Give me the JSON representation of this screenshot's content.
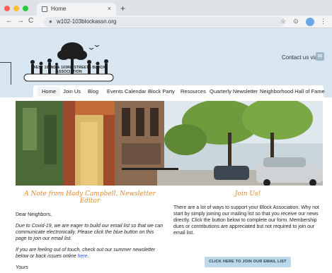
{
  "browser": {
    "tab_title": "Home",
    "tab_close": "×",
    "new_tab": "+",
    "url": "w102-103blockassn.org",
    "back": "←",
    "forward": "→",
    "reload": "C",
    "star": "☆",
    "ext": "⊙",
    "menu": "⋮",
    "dot_colors": [
      "#ff5f57",
      "#febc2e",
      "#28c840"
    ]
  },
  "header": {
    "logo_text": "WEST 102ND & 103RD STREETS BLOCK ASSOCIATION",
    "contact": "Contact us via"
  },
  "nav": {
    "items": [
      "Home",
      "Join Us",
      "Blog",
      "Events Calendar",
      "Block Party",
      "Resources",
      "Quarterly Newsletter",
      "Neighborhood Hall of Fame"
    ]
  },
  "left": {
    "title": "A Note from Hady Campbell, Newsletter Editor",
    "greeting": "Dear Neighbors,",
    "p1": "Due to Covid-19, we are eager to build our email list so that we can communicate electronically. Please click the blue button on this page to join our email list.",
    "p2_a": "If you are feeling out of touch, check out our summer newsletter below or back issues online ",
    "p2_link": "here",
    "p2_b": ".",
    "closing": "Yours"
  },
  "right": {
    "title": "Join Us!",
    "p1": "There are a lot of ways to support your Block Association. Why not start by simply joining our mailing list so that you receive our news directly. Click the button below to complete our form. Membership dues or contributions are appreciated but not required to join our email list.",
    "button": "CLICK HERE TO JOIN OUR EMAIL LIST"
  }
}
